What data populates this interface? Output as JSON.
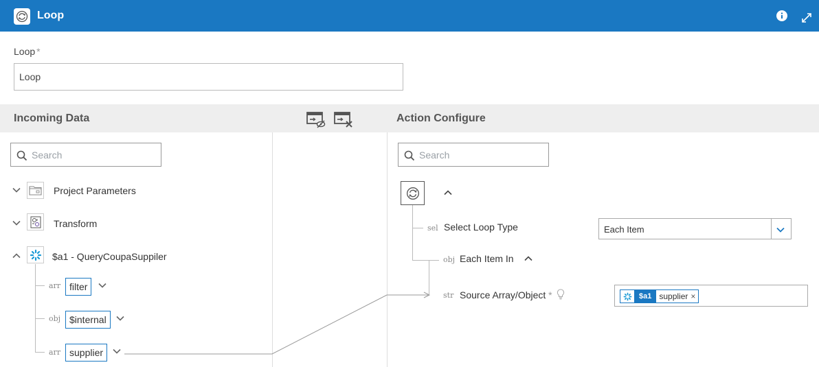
{
  "header": {
    "title": "Loop"
  },
  "loop_field": {
    "label": "Loop",
    "required_mark": "*",
    "value": "Loop"
  },
  "incoming": {
    "title": "Incoming Data",
    "search_placeholder": "Search",
    "nodes": [
      {
        "label": "Project Parameters"
      },
      {
        "label": "Transform"
      },
      {
        "label": "$a1 - QueryCoupaSuppiler"
      }
    ],
    "children": [
      {
        "type": "arr",
        "label": "filter"
      },
      {
        "type": "obj",
        "label": "$internal"
      },
      {
        "type": "arr",
        "label": "supplier"
      }
    ]
  },
  "action": {
    "title": "Action Configure",
    "search_placeholder": "Search",
    "loop_type": {
      "type": "sel",
      "label": "Select Loop Type",
      "value": "Each Item"
    },
    "each_item": {
      "type": "obj",
      "label": "Each Item In"
    },
    "source": {
      "type": "str",
      "label": "Source Array/Object",
      "required_mark": "*",
      "chip_source": "$a1",
      "chip_field": "supplier",
      "chip_remove": "×"
    }
  },
  "colors": {
    "accent": "#1a78c2",
    "header_bg": "#1a78c2",
    "section_bg": "#eeeeee"
  }
}
